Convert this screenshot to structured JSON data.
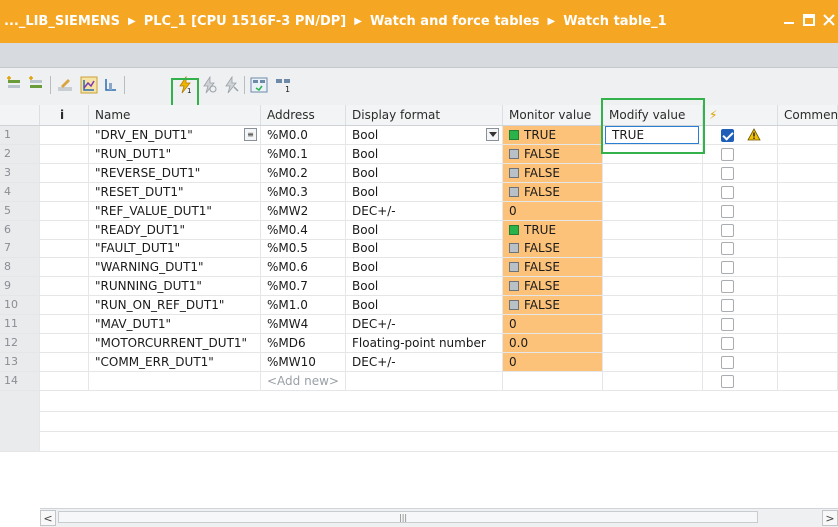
{
  "titlebar": {
    "crumbs": [
      "..._LIB_SIEMENS",
      "PLC_1 [CPU 1516F-3 PN/DP]",
      "Watch and force tables",
      "Watch table_1"
    ],
    "separator": "▶",
    "controls": [
      "minimize-icon",
      "restore-icon",
      "close-icon"
    ]
  },
  "toolbar": {
    "icons": [
      "insert-row-icon",
      "add-row-icon",
      "rename-icon",
      "monitor-all-icon",
      "monitor-once-icon",
      "modify-now-icon",
      "modify-trigger-icon",
      "enable-peripheral-icon",
      "show-all-modify-columns-icon",
      "show-advanced-icon"
    ]
  },
  "columns": {
    "info": "i",
    "name": "Name",
    "address": "Address",
    "display_format": "Display format",
    "monitor_value": "Monitor value",
    "modify_value": "Modify value",
    "modify_flag": "⚡",
    "comment": "Comment"
  },
  "rows": [
    {
      "num": "1",
      "name": "\"DRV_EN_DUT1\"",
      "address": "%M0.0",
      "format": "Bool",
      "monitor": "TRUE",
      "mon_state": "on",
      "modify": "TRUE",
      "checked": true,
      "warning": true
    },
    {
      "num": "2",
      "name": "\"RUN_DUT1\"",
      "address": "%M0.1",
      "format": "Bool",
      "monitor": "FALSE",
      "mon_state": "off",
      "modify": "",
      "checked": false,
      "warning": false
    },
    {
      "num": "3",
      "name": "\"REVERSE_DUT1\"",
      "address": "%M0.2",
      "format": "Bool",
      "monitor": "FALSE",
      "mon_state": "off",
      "modify": "",
      "checked": false,
      "warning": false
    },
    {
      "num": "4",
      "name": "\"RESET_DUT1\"",
      "address": "%M0.3",
      "format": "Bool",
      "monitor": "FALSE",
      "mon_state": "off",
      "modify": "",
      "checked": false,
      "warning": false
    },
    {
      "num": "5",
      "name": "\"REF_VALUE_DUT1\"",
      "address": "%MW2",
      "format": "DEC+/-",
      "monitor": "0",
      "mon_state": "num",
      "modify": "",
      "checked": false,
      "warning": false
    },
    {
      "num": "6",
      "name": "\"READY_DUT1\"",
      "address": "%M0.4",
      "format": "Bool",
      "monitor": "TRUE",
      "mon_state": "on",
      "modify": "",
      "checked": false,
      "warning": false
    },
    {
      "num": "7",
      "name": "\"FAULT_DUT1\"",
      "address": "%M0.5",
      "format": "Bool",
      "monitor": "FALSE",
      "mon_state": "off",
      "modify": "",
      "checked": false,
      "warning": false
    },
    {
      "num": "8",
      "name": "\"WARNING_DUT1\"",
      "address": "%M0.6",
      "format": "Bool",
      "monitor": "FALSE",
      "mon_state": "off",
      "modify": "",
      "checked": false,
      "warning": false
    },
    {
      "num": "9",
      "name": "\"RUNNING_DUT1\"",
      "address": "%M0.7",
      "format": "Bool",
      "monitor": "FALSE",
      "mon_state": "off",
      "modify": "",
      "checked": false,
      "warning": false
    },
    {
      "num": "10",
      "name": "\"RUN_ON_REF_DUT1\"",
      "address": "%M1.0",
      "format": "Bool",
      "monitor": "FALSE",
      "mon_state": "off",
      "modify": "",
      "checked": false,
      "warning": false
    },
    {
      "num": "11",
      "name": "\"MAV_DUT1\"",
      "address": "%MW4",
      "format": "DEC+/-",
      "monitor": "0",
      "mon_state": "num",
      "modify": "",
      "checked": false,
      "warning": false
    },
    {
      "num": "12",
      "name": "\"MOTORCURRENT_DUT1\"",
      "address": "%MD6",
      "format": "Floating-point number",
      "monitor": "0.0",
      "mon_state": "num",
      "modify": "",
      "checked": false,
      "warning": false
    },
    {
      "num": "13",
      "name": "\"COMM_ERR_DUT1\"",
      "address": "%MW10",
      "format": "DEC+/-",
      "monitor": "0",
      "mon_state": "num",
      "modify": "",
      "checked": false,
      "warning": false
    },
    {
      "num": "14",
      "name": "",
      "address": "<Add new>",
      "format": "",
      "monitor": "",
      "mon_state": "empty",
      "modify": "",
      "checked": false,
      "warning": false
    }
  ],
  "colors": {
    "titlebar": "#f5a623",
    "monitor_bg": "#fcc27a",
    "true_indicator": "#2ab34a",
    "false_indicator": "#b9c1c8",
    "highlight_box": "#33b14a"
  }
}
